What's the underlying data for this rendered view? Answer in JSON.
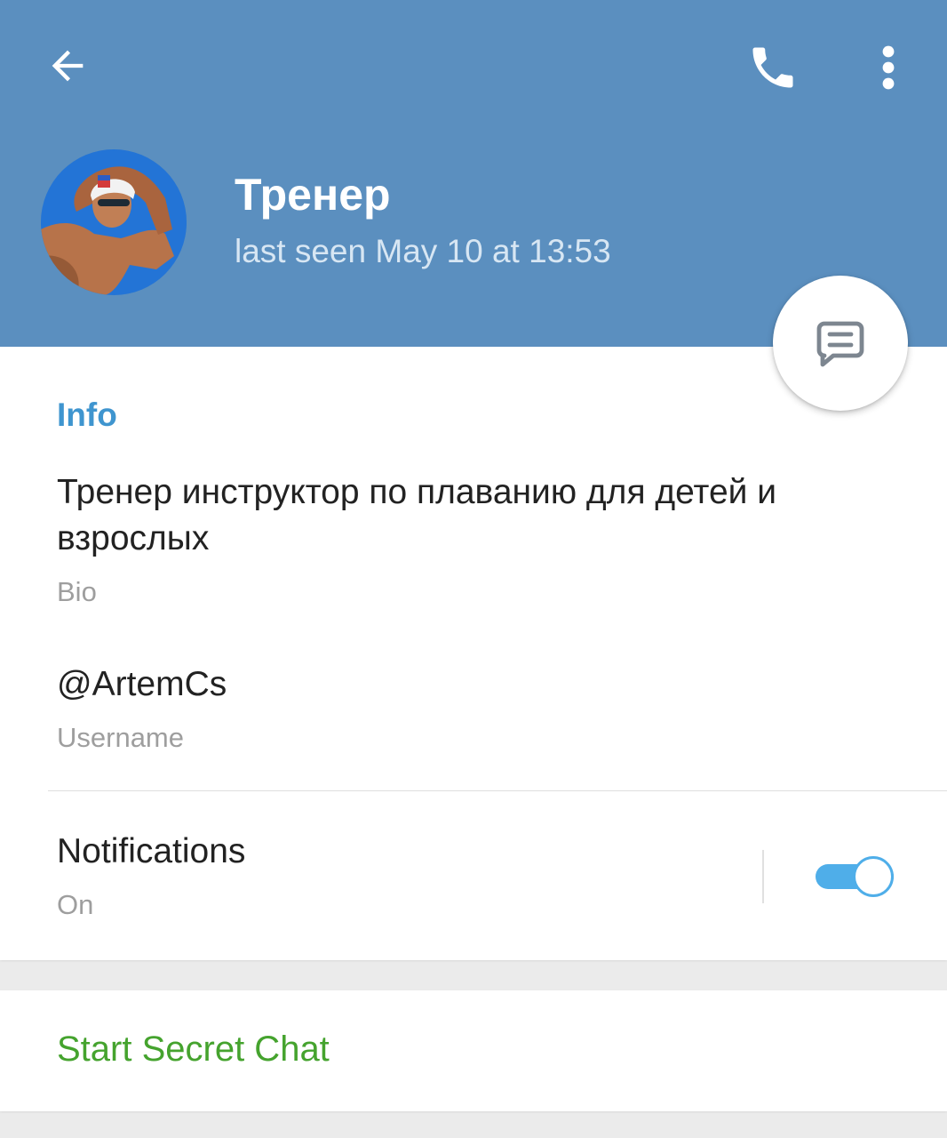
{
  "header": {
    "title": "Тренер",
    "status": "last seen May 10 at 13:53",
    "background_color": "#5b8fbf",
    "back_icon": "arrow-left-icon",
    "call_icon": "phone-icon",
    "menu_icon": "more-vertical-icon"
  },
  "fab": {
    "icon": "message-icon"
  },
  "info": {
    "section_title": "Info",
    "bio": {
      "value": "Тренер инструктор по плаванию для детей и взрослых",
      "label": "Bio"
    },
    "username": {
      "value": "@ArtemCs",
      "label": "Username"
    },
    "notifications": {
      "value": "Notifications",
      "label": "On",
      "enabled": true
    }
  },
  "actions": {
    "secret_chat": "Start Secret Chat"
  },
  "colors": {
    "accent": "#3f95cf",
    "toggle": "#4faee9",
    "secret_chat": "#45a32e"
  }
}
